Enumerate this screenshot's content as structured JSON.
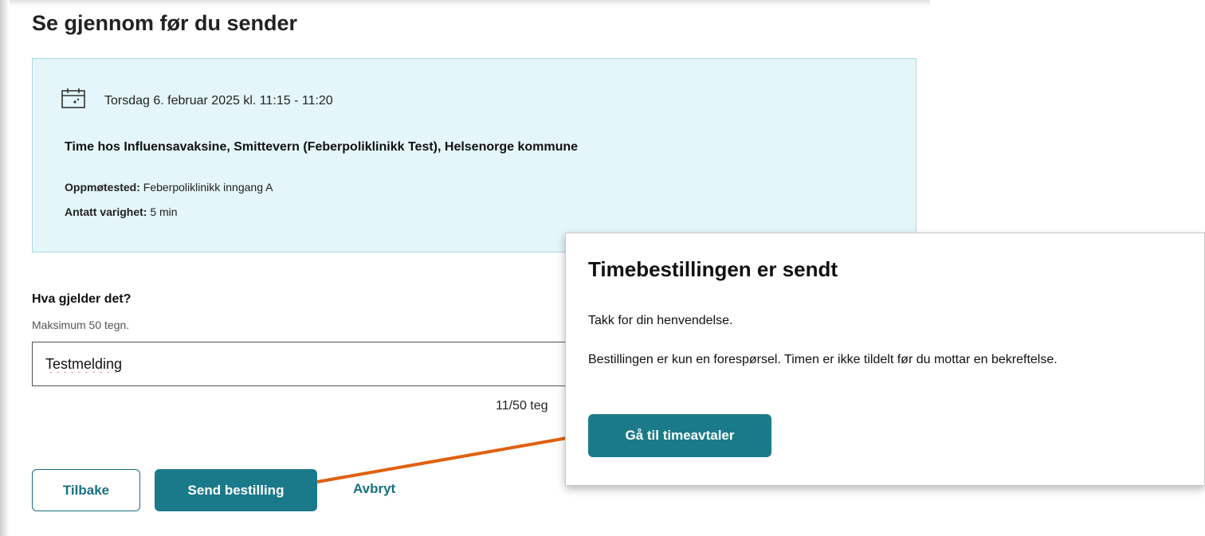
{
  "page": {
    "title": "Se gjennom før du sender"
  },
  "summary": {
    "date": "Torsdag 6. februar 2025 kl. 11:15 - 11:20",
    "appointment_title": "Time hos Influensavaksine, Smittevern (Feberpoliklinikk Test), Helsenorge kommune",
    "location_label": "Oppmøtested:",
    "location_value": "Feberpoliklinikk inngang A",
    "duration_label": "Antatt varighet:",
    "duration_value": "5 min",
    "icon": "calendar-icon"
  },
  "form": {
    "question_label": "Hva gjelder det?",
    "hint": "Maksimum 50 tegn.",
    "message_value": "Testmelding",
    "counter": "11/50 teg"
  },
  "actions": {
    "back_label": "Tilbake",
    "send_label": "Send bestilling",
    "cancel_label": "Avbryt"
  },
  "dialog": {
    "title": "Timebestillingen er sendt",
    "thanks": "Takk for din henvendelse.",
    "info": "Bestillingen er kun en forespørsel. Timen er ikke tildelt før du mottar en bekreftelse.",
    "button_label": "Gå til timeavtaler"
  },
  "colors": {
    "primary": "#1b7a8a",
    "summary_bg": "#e4f6fa",
    "annotation_arrow": "#e0600f"
  }
}
